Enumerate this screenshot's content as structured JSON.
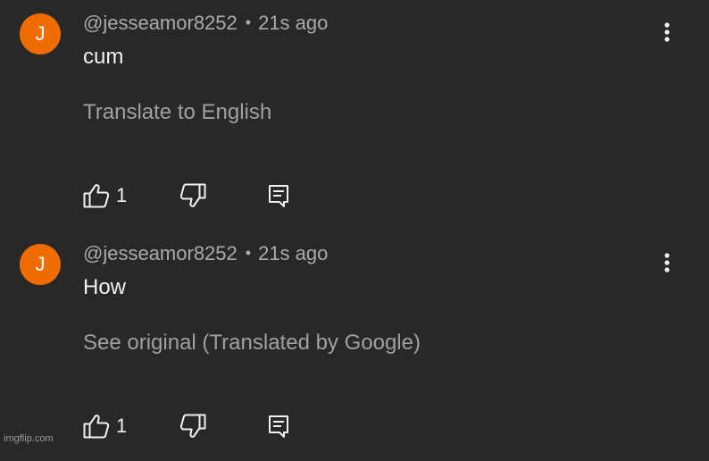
{
  "comments": [
    {
      "avatar_letter": "J",
      "author": "@jesseamor8252",
      "separator": "•",
      "time": "21s ago",
      "text": "cum",
      "translate_link": "Translate to English",
      "like_count": "1",
      "avatar_color": "#ef6c00"
    },
    {
      "avatar_letter": "J",
      "author": "@jesseamor8252",
      "separator": "•",
      "time": "21s ago",
      "text": "How",
      "translate_link": "See original (Translated by Google)",
      "like_count": "1",
      "avatar_color": "#ef6c00"
    }
  ],
  "watermark": "imgflip.com",
  "icons": {
    "like": "thumbs-up-icon",
    "dislike": "thumbs-down-icon",
    "reply": "comment-icon",
    "more": "more-vertical-icon"
  }
}
